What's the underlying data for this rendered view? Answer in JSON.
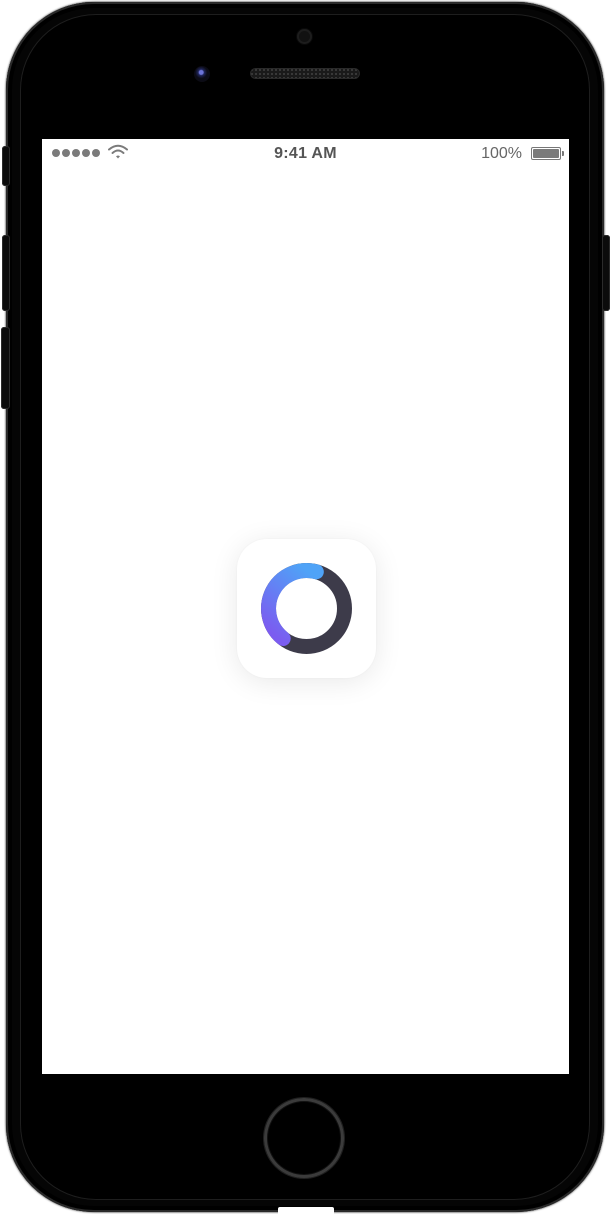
{
  "status_bar": {
    "signal_dots": 5,
    "wifi_icon": "wifi-icon",
    "time": "9:41 AM",
    "battery_percent": "100%",
    "battery_level": 1.0
  },
  "splash": {
    "app_icon": "loading-ring-icon",
    "colors": {
      "ring_gradient_start": "#4fa3f7",
      "ring_gradient_end": "#7b5cf0",
      "ring_dark": "#3d3b4a",
      "background": "#ffffff"
    }
  },
  "device": {
    "frame_color": "#050505",
    "home_button_icon": "home-button-icon"
  }
}
